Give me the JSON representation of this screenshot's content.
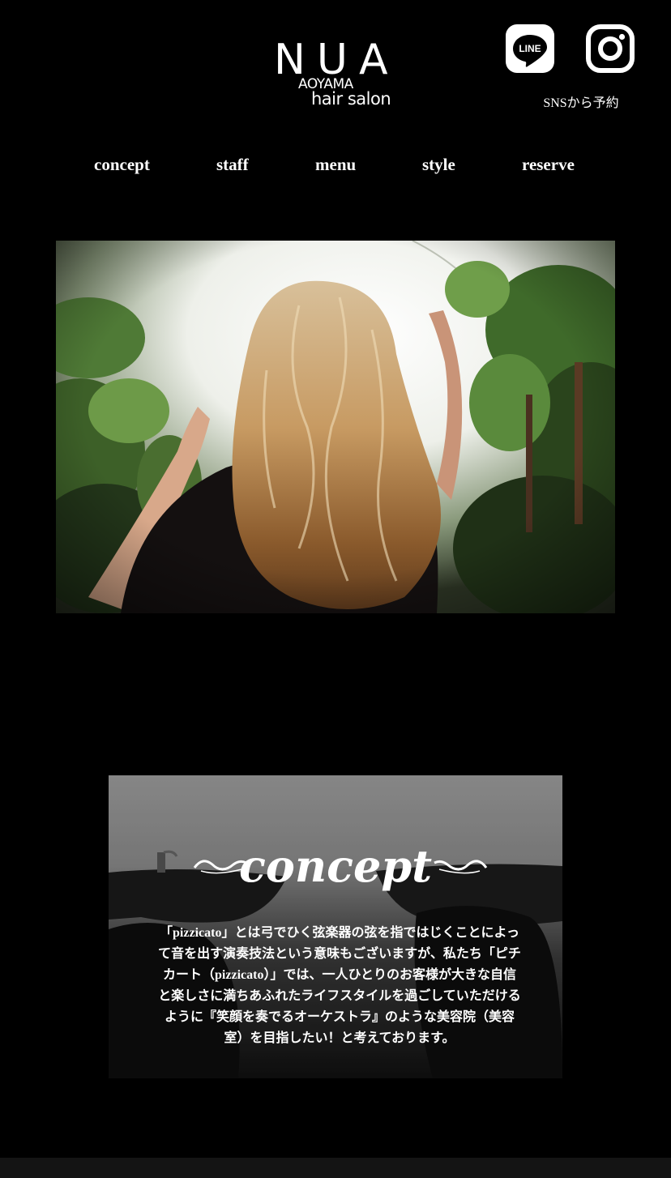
{
  "header": {
    "logo": {
      "main": "NUA",
      "sub_line1": "AOYAMA",
      "sub_line2": "hair salon"
    },
    "sns": {
      "line_icon": "line-icon",
      "line_icon_text": "LINE",
      "instagram_icon": "instagram-icon",
      "label": "SNSから予約"
    }
  },
  "nav": {
    "items": [
      {
        "label": "concept"
      },
      {
        "label": "staff"
      },
      {
        "label": "menu"
      },
      {
        "label": "style"
      },
      {
        "label": "reserve"
      }
    ]
  },
  "hero": {
    "image": "woman-with-wavy-blonde-hair-among-plants"
  },
  "concept": {
    "title": "concept",
    "body": "「pizzicato」とは弓でひく弦楽器の弦を指ではじくことによって音を出す演奏技法という意味もございますが、私たち「ピチカート（pizzicato）」では、一人ひとりのお客様が大きな自信と楽しさに満ちあふれたライフスタイルを過ごしていただけるように『笑顔を奏でるオーケストラ』のような美容院（美容室）を目指したい！と考えております。"
  },
  "colors": {
    "background": "#000000",
    "text": "#ffffff",
    "footer": "#141414"
  }
}
